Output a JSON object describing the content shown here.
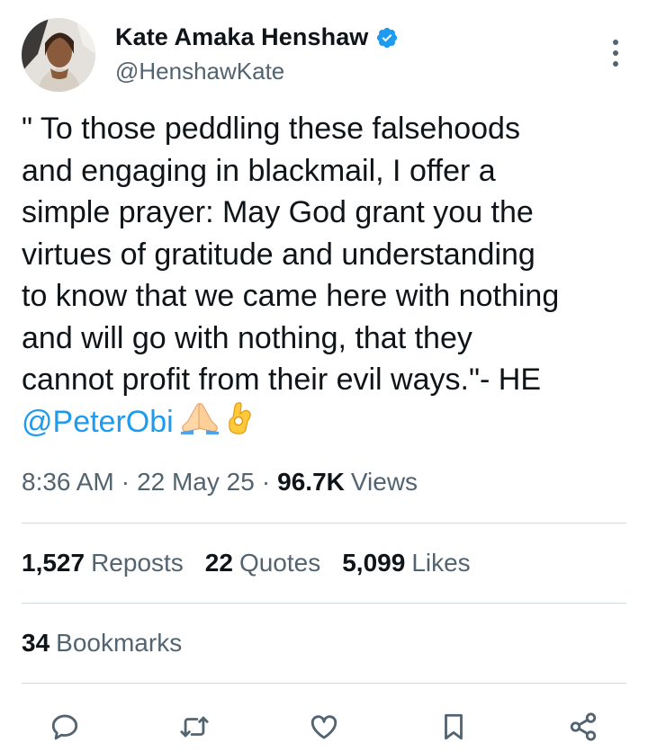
{
  "author": {
    "display_name": "Kate Amaka Henshaw",
    "handle": "@HenshawKate",
    "verified": true,
    "verified_color": "#1d9bf0"
  },
  "tweet": {
    "text": "\" To those peddling these falsehoods\nand engaging in blackmail, I offer a\nsimple prayer: May God grant you the\nvirtues of gratitude and understanding\nto know that we came here with nothing\nand will go with nothing, that they\ncannot profit from their evil ways.\"- HE\n",
    "mention": "@PeterObi",
    "emojis": [
      "folded-hands-emoji",
      "ok-hand-emoji"
    ]
  },
  "meta": {
    "time": "8:36 AM",
    "separator": "·",
    "date": "22 May 25",
    "views_count": "96.7K",
    "views_label": "Views"
  },
  "stats": {
    "reposts_count": "1,527",
    "reposts_label": "Reposts",
    "quotes_count": "22",
    "quotes_label": "Quotes",
    "likes_count": "5,099",
    "likes_label": "Likes",
    "bookmarks_count": "34",
    "bookmarks_label": "Bookmarks"
  },
  "actions": [
    "reply-icon",
    "retweet-icon",
    "like-icon",
    "bookmark-icon",
    "share-icon"
  ],
  "colors": {
    "text": "#0f1419",
    "secondary": "#536471",
    "accent": "#1d9bf0",
    "divider": "#cfd9de"
  }
}
